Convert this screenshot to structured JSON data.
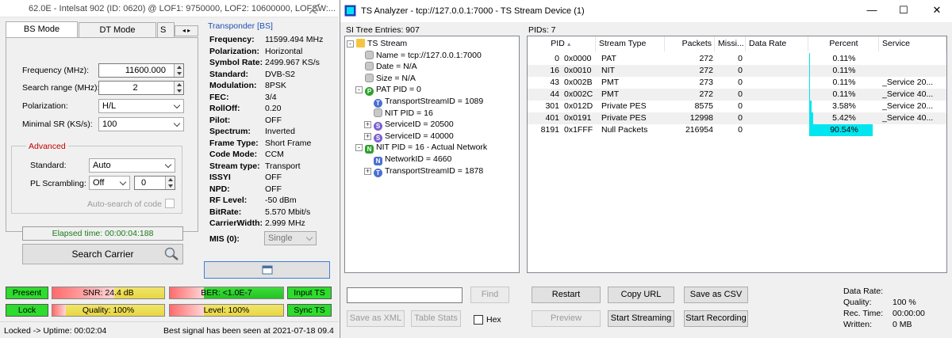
{
  "left_window": {
    "title": "62.0E - Intelsat 902 (ID: 0620) @ LOF1: 9750000, LOF2: 10600000, LOFSW:...",
    "tabs": {
      "bs": "BS Mode",
      "dt": "DT Mode",
      "s": "S"
    },
    "form": {
      "frequency_label": "Frequency (MHz):",
      "frequency_value": "11600.000",
      "search_range_label": "Search range (MHz):",
      "search_range_value": "2",
      "polarization_label": "Polarization:",
      "polarization_value": "H/L",
      "minimal_sr_label": "Minimal SR (KS/s):",
      "minimal_sr_value": "100"
    },
    "advanced": {
      "caption": "Advanced",
      "standard_label": "Standard:",
      "standard_value": "Auto",
      "pl_label": "PL Scrambling:",
      "pl_value": "Off",
      "pl_number": "0",
      "autosearch_label": "Auto-search of code"
    },
    "elapsed": "Elapsed time: 00:00:04:188",
    "search_button": "Search Carrier",
    "transponder": {
      "caption": "Transponder [BS]",
      "rows": [
        {
          "k": "Frequency:",
          "v": "11599.494 MHz"
        },
        {
          "k": "Polarization:",
          "v": "Horizontal"
        },
        {
          "k": "Symbol Rate:",
          "v": "2499.967 KS/s"
        },
        {
          "k": "Standard:",
          "v": "DVB-S2"
        },
        {
          "k": "Modulation:",
          "v": "8PSK"
        },
        {
          "k": "FEC:",
          "v": "3/4"
        },
        {
          "k": "RollOff:",
          "v": "0.20"
        },
        {
          "k": "Pilot:",
          "v": "OFF"
        },
        {
          "k": "Spectrum:",
          "v": "Inverted"
        },
        {
          "k": "Frame Type:",
          "v": "Short Frame"
        },
        {
          "k": "Code Mode:",
          "v": "CCM"
        },
        {
          "k": "Stream type:",
          "v": "Transport"
        },
        {
          "k": "ISSYI",
          "v": "OFF"
        },
        {
          "k": "NPD:",
          "v": "OFF"
        },
        {
          "k": "RF Level:",
          "v": "-50 dBm"
        },
        {
          "k": "BitRate:",
          "v": "5.570 Mbit/s"
        },
        {
          "k": "CarrierWidth:",
          "v": "2.999 MHz"
        }
      ],
      "mis_label": "MIS (0):",
      "mis_value": "Single"
    },
    "status": {
      "present": "Present",
      "snr": "SNR: 24.4 dB",
      "ber": "BER: <1.0E-7",
      "input_ts": "Input TS",
      "lock": "Lock",
      "quality": "Quality: 100%",
      "level": "Level: 100%",
      "sync_ts": "Sync TS",
      "snr_level": 0.55,
      "quality_level": 0.12,
      "ber_level": 0.3,
      "level_level": 0.3
    },
    "footer": {
      "left": "Locked -> Uptime: 00:02:04",
      "right": "Best signal has been seen at 2021-07-18 09.4"
    }
  },
  "right_window": {
    "title": "TS Analyzer - tcp://127.0.0.1:7000 - TS Stream Device (1)",
    "si_label": "SI Tree Entries: 907",
    "pids_label": "PIDs: 7",
    "tree": [
      {
        "text": "TS Stream",
        "badge": "folder",
        "lvl": 0,
        "exp": "-"
      },
      {
        "text": "Name = tcp://127.0.0.1:7000",
        "badge": "gray",
        "lvl": 1
      },
      {
        "text": "Date = N/A",
        "badge": "gray",
        "lvl": 1
      },
      {
        "text": "Size = N/A",
        "badge": "gray",
        "lvl": 1
      },
      {
        "text": "PAT PID = 0",
        "badge": "P",
        "lvl": 1,
        "exp": "-"
      },
      {
        "text": "TransportStreamID = 1089",
        "badge": "T",
        "lvl": 2
      },
      {
        "text": "NIT PID = 16",
        "badge": "gray",
        "lvl": 2
      },
      {
        "text": "ServiceID = 20500",
        "badge": "S",
        "lvl": 2,
        "exp": "+"
      },
      {
        "text": "ServiceID = 40000",
        "badge": "S",
        "lvl": 2,
        "exp": "+"
      },
      {
        "text": "NIT PID = 16 - Actual Network",
        "badge": "N",
        "lvl": 1,
        "exp": "-"
      },
      {
        "text": "NetworkID = 4660",
        "badge": "Nb",
        "lvl": 2
      },
      {
        "text": "TransportStreamID = 1878",
        "badge": "T",
        "lvl": 2,
        "exp": "+"
      }
    ],
    "columns": {
      "pid": "PID",
      "stream_type": "Stream Type",
      "packets": "Packets",
      "missing": "Missi...",
      "data_rate": "Data Rate",
      "percent": "Percent",
      "service": "Service"
    },
    "rows": [
      {
        "pid": "0",
        "hex": "0x0000",
        "type": "PAT",
        "packets": "272",
        "missing": "0",
        "percent": "0.11%",
        "pct": 0.11,
        "service": ""
      },
      {
        "pid": "16",
        "hex": "0x0010",
        "type": "NIT",
        "packets": "272",
        "missing": "0",
        "percent": "0.11%",
        "pct": 0.11,
        "service": ""
      },
      {
        "pid": "43",
        "hex": "0x002B",
        "type": "PMT",
        "packets": "273",
        "missing": "0",
        "percent": "0.11%",
        "pct": 0.11,
        "service": "_Service 20..."
      },
      {
        "pid": "44",
        "hex": "0x002C",
        "type": "PMT",
        "packets": "272",
        "missing": "0",
        "percent": "0.11%",
        "pct": 0.11,
        "service": "_Service 40..."
      },
      {
        "pid": "301",
        "hex": "0x012D",
        "type": "Private PES",
        "packets": "8575",
        "missing": "0",
        "percent": "3.58%",
        "pct": 3.58,
        "service": "_Service 20..."
      },
      {
        "pid": "401",
        "hex": "0x0191",
        "type": "Private PES",
        "packets": "12998",
        "missing": "0",
        "percent": "5.42%",
        "pct": 5.42,
        "service": "_Service 40..."
      },
      {
        "pid": "8191",
        "hex": "0x1FFF",
        "type": "Null Packets",
        "packets": "216954",
        "missing": "0",
        "percent": "90.54%",
        "pct": 90.54,
        "service": ""
      }
    ],
    "buttons": {
      "find": "Find",
      "save_xml": "Save as XML",
      "table_stats": "Table Stats",
      "hex": "Hex",
      "restart": "Restart",
      "copy_url": "Copy URL",
      "save_csv": "Save as CSV",
      "preview": "Preview",
      "start_streaming": "Start Streaming",
      "start_recording": "Start Recording"
    },
    "stats": {
      "data_rate_label": "Data Rate:",
      "quality_label": "Quality:",
      "quality_value": "100 %",
      "rec_label": "Rec. Time:",
      "rec_value": "00:00:00",
      "written_label": "Written:",
      "written_value": "0 MB"
    },
    "colors": {
      "percent_bar": "#00e5f0",
      "title_icon": "#1f3fbf"
    }
  }
}
